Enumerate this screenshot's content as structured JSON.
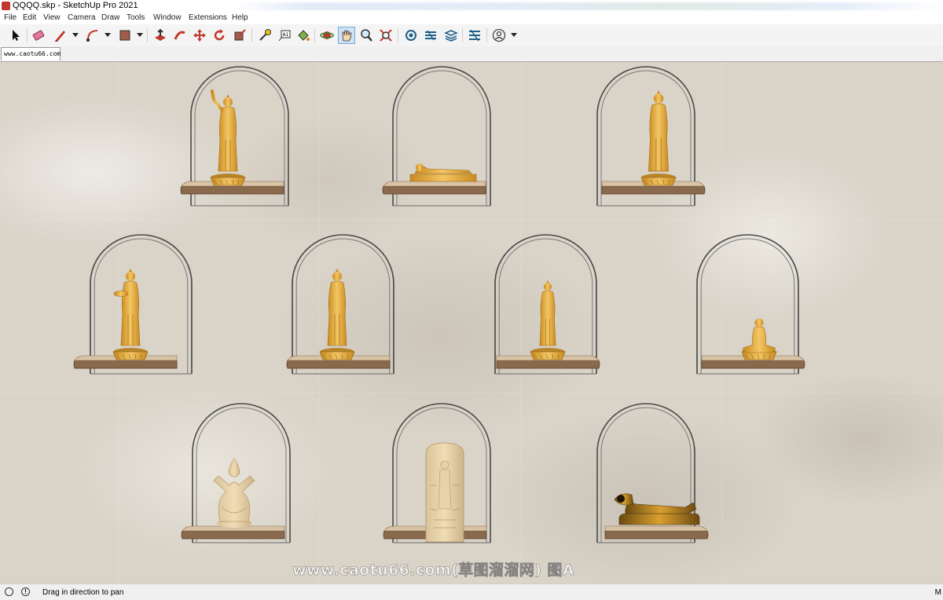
{
  "window": {
    "title": "QQQQ.skp - SketchUp Pro 2021"
  },
  "menu": [
    "File",
    "Edit",
    "View",
    "Camera",
    "Draw",
    "Tools",
    "Window",
    "Extensions",
    "Help"
  ],
  "toolbar": {
    "tools": [
      {
        "id": "select",
        "icon": "select-arrow-icon"
      },
      {
        "id": "eraser",
        "icon": "eraser-icon"
      },
      {
        "id": "line",
        "icon": "pencil-icon"
      },
      {
        "id": "arc",
        "icon": "arc-icon"
      },
      {
        "id": "shape",
        "icon": "rectangle-icon"
      },
      {
        "id": "push-pull",
        "icon": "push-pull-icon"
      },
      {
        "id": "follow-me",
        "icon": "follow-me-icon"
      },
      {
        "id": "move",
        "icon": "move-icon"
      },
      {
        "id": "rotate",
        "icon": "rotate-icon"
      },
      {
        "id": "scale",
        "icon": "scale-icon"
      },
      {
        "id": "tape-measure",
        "icon": "tape-measure-icon"
      },
      {
        "id": "text",
        "icon": "text-icon"
      },
      {
        "id": "paint-bucket",
        "icon": "paint-bucket-icon"
      },
      {
        "id": "orbit",
        "icon": "orbit-icon"
      },
      {
        "id": "pan",
        "icon": "pan-hand-icon",
        "active": true
      },
      {
        "id": "zoom",
        "icon": "zoom-icon"
      },
      {
        "id": "zoom-extents",
        "icon": "zoom-extents-icon"
      },
      {
        "id": "3d-warehouse",
        "icon": "warehouse-icon"
      },
      {
        "id": "extension-warehouse",
        "icon": "extension-warehouse-icon"
      },
      {
        "id": "layout",
        "icon": "layout-icon"
      },
      {
        "id": "extension-manager",
        "icon": "extension-manager-icon"
      },
      {
        "id": "account",
        "icon": "user-account-icon"
      }
    ]
  },
  "scene_tab": {
    "label": "www.caotu66.com"
  },
  "viewport": {
    "colors": {
      "statue_gold": "#e8b24a",
      "shelf_wood": "#8a6a4c",
      "shelf_top": "#d7c3a6",
      "arch_frame": "#5a5a5a"
    },
    "niches": [
      {
        "id": "n1",
        "figure": "standing-raised-hand"
      },
      {
        "id": "n2",
        "figure": "reclining"
      },
      {
        "id": "n3",
        "figure": "standing"
      },
      {
        "id": "n4",
        "figure": "standing-bowl"
      },
      {
        "id": "n5",
        "figure": "standing"
      },
      {
        "id": "n6",
        "figure": "standing-small"
      },
      {
        "id": "n7",
        "figure": "seated"
      },
      {
        "id": "n8",
        "figure": "multi-armed-seated"
      },
      {
        "id": "n9",
        "figure": "carved-stele"
      },
      {
        "id": "n10",
        "figure": "reclining-dark"
      }
    ]
  },
  "watermark": "www.caotu66.com(草图溜溜网) 图A",
  "status": {
    "message": "Drag in direction to pan",
    "right_text": "M"
  }
}
